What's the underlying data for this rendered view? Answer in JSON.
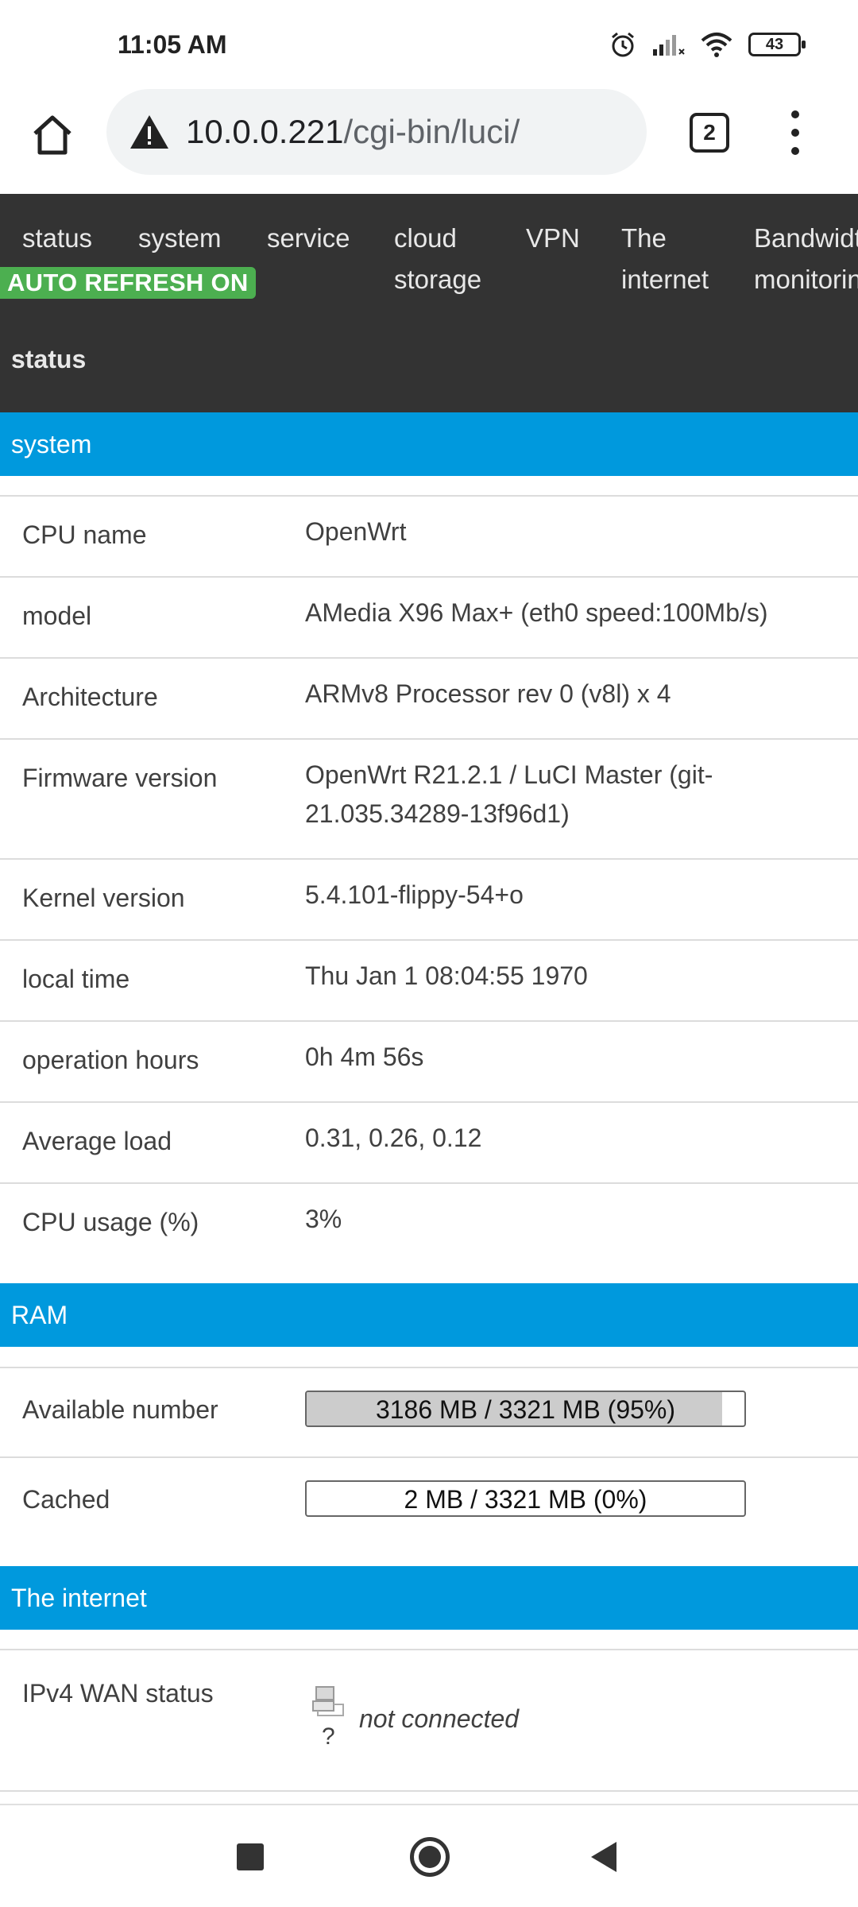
{
  "status_bar": {
    "time": "11:05 AM",
    "battery": "43",
    "icons": [
      "alarm-icon",
      "signal-icon",
      "wifi-icon",
      "battery-icon"
    ]
  },
  "browser": {
    "url_host": "10.0.0.221",
    "url_path": "/cgi-bin/luci/",
    "tab_count": "2"
  },
  "nav": {
    "items": [
      "status",
      "system",
      "service",
      "cloud storage",
      "VPN",
      "The internet",
      "Bandwidth monitoring"
    ],
    "auto_refresh": "AUTO REFRESH ON"
  },
  "page": {
    "title": "status"
  },
  "system": {
    "title": "system",
    "rows": [
      {
        "label": "CPU name",
        "value": "OpenWrt"
      },
      {
        "label": "model",
        "value": "AMedia X96 Max+ (eth0 speed:100Mb/s)"
      },
      {
        "label": "Architecture",
        "value": "ARMv8 Processor rev 0 (v8l) x 4"
      },
      {
        "label": "Firmware version",
        "value": "OpenWrt R21.2.1 / LuCI Master (git-21.035.34289-13f96d1)"
      },
      {
        "label": "Kernel version",
        "value": "5.4.101-flippy-54+o"
      },
      {
        "label": "local time",
        "value": "Thu Jan 1 08:04:55 1970"
      },
      {
        "label": "operation hours",
        "value": "0h 4m 56s"
      },
      {
        "label": "Average load",
        "value": "0.31, 0.26, 0.12"
      },
      {
        "label": "CPU usage (%)",
        "value": "3%"
      }
    ]
  },
  "ram": {
    "title": "RAM",
    "available": {
      "label": "Available number",
      "text": "3186 MB / 3321 MB (95%)",
      "percent": 95
    },
    "cached": {
      "label": "Cached",
      "text": "2 MB / 3321 MB (0%)",
      "percent": 0
    }
  },
  "internet": {
    "title": "The internet",
    "wan": {
      "label": "IPv4 WAN status",
      "icon_caption": "?",
      "status": "not connected"
    }
  },
  "colors": {
    "nav_bg": "#333333",
    "section_bar": "#0099dd",
    "badge": "#4caf50"
  }
}
